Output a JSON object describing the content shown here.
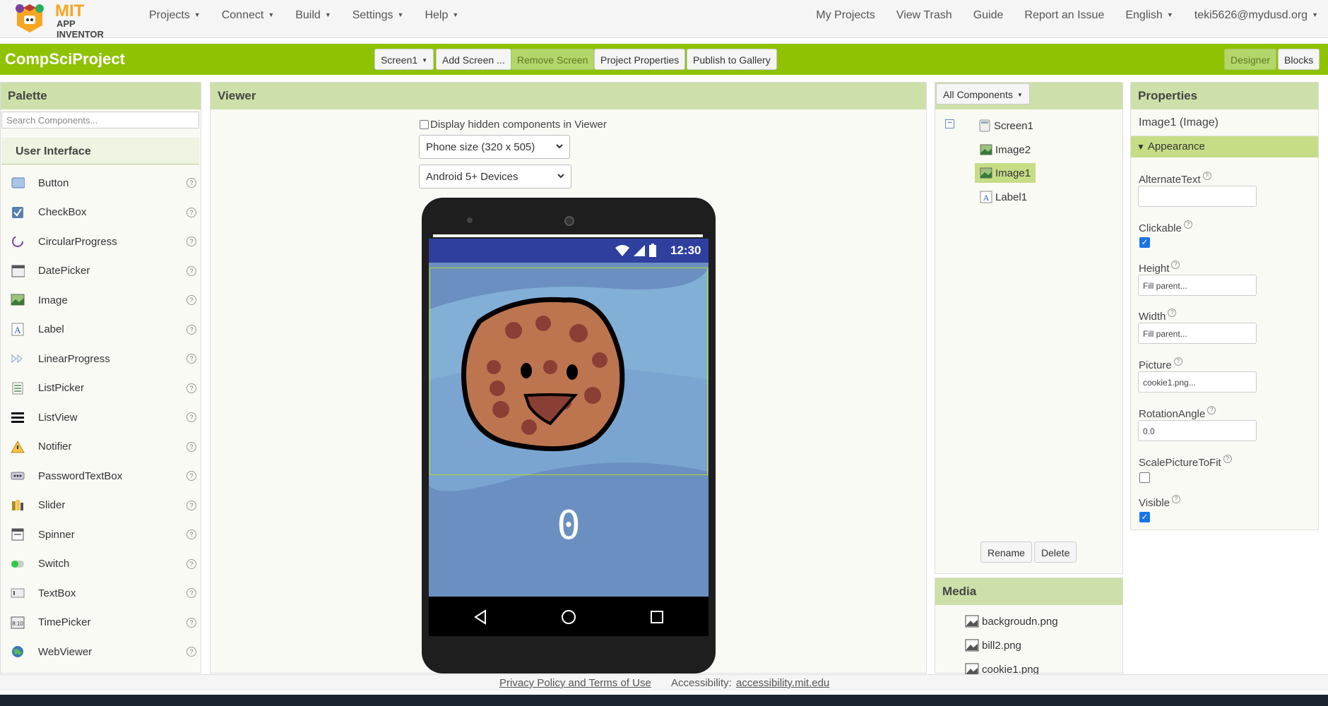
{
  "topnav": {
    "logo_mit": "MIT",
    "logo_sub": "APP INVENTOR",
    "left": [
      {
        "label": "Projects",
        "key": "projects"
      },
      {
        "label": "Connect",
        "key": "connect"
      },
      {
        "label": "Build",
        "key": "build"
      },
      {
        "label": "Settings",
        "key": "settings"
      },
      {
        "label": "Help",
        "key": "help"
      }
    ],
    "right": {
      "my_projects": "My Projects",
      "view_trash": "View Trash",
      "guide": "Guide",
      "report": "Report an Issue",
      "language": "English",
      "account": "teki5626@mydusd.org"
    }
  },
  "toolbar": {
    "project_name": "CompSciProject",
    "screen_select": "Screen1",
    "add_screen": "Add Screen ...",
    "remove_screen": "Remove Screen",
    "project_properties": "Project Properties",
    "publish": "Publish to Gallery",
    "designer": "Designer",
    "blocks": "Blocks"
  },
  "palette": {
    "title": "Palette",
    "search_placeholder": "Search Components...",
    "category": "User Interface",
    "items": [
      {
        "label": "Button",
        "icon": "button-icon"
      },
      {
        "label": "CheckBox",
        "icon": "checkbox-icon"
      },
      {
        "label": "CircularProgress",
        "icon": "circular-progress-icon"
      },
      {
        "label": "DatePicker",
        "icon": "datepicker-icon"
      },
      {
        "label": "Image",
        "icon": "image-icon"
      },
      {
        "label": "Label",
        "icon": "label-icon"
      },
      {
        "label": "LinearProgress",
        "icon": "linear-progress-icon"
      },
      {
        "label": "ListPicker",
        "icon": "listpicker-icon"
      },
      {
        "label": "ListView",
        "icon": "listview-icon"
      },
      {
        "label": "Notifier",
        "icon": "notifier-icon"
      },
      {
        "label": "PasswordTextBox",
        "icon": "password-icon"
      },
      {
        "label": "Slider",
        "icon": "slider-icon"
      },
      {
        "label": "Spinner",
        "icon": "spinner-icon"
      },
      {
        "label": "Switch",
        "icon": "switch-icon"
      },
      {
        "label": "TextBox",
        "icon": "textbox-icon"
      },
      {
        "label": "TimePicker",
        "icon": "timepicker-icon"
      },
      {
        "label": "WebViewer",
        "icon": "webviewer-icon"
      }
    ]
  },
  "viewer": {
    "title": "Viewer",
    "hidden_checkbox_label": "Display hidden components in Viewer",
    "size_select": "Phone size (320 x 505)",
    "device_select": "Android 5+ Devices",
    "status_time": "12:30",
    "label_text": "0"
  },
  "components": {
    "filter": "All Components",
    "tree": [
      {
        "label": "Screen1",
        "icon": "screen-icon"
      },
      {
        "label": "Image2",
        "icon": "image-icon"
      },
      {
        "label": "Image1",
        "icon": "image-icon",
        "selected": true
      },
      {
        "label": "Label1",
        "icon": "label-icon"
      }
    ],
    "rename": "Rename",
    "delete": "Delete"
  },
  "media": {
    "title": "Media",
    "files": [
      "backgroudn.png",
      "bill2.png",
      "cookie1.png"
    ]
  },
  "properties": {
    "title": "Properties",
    "component": "Image1 (Image)",
    "section": "Appearance",
    "alternate_text_label": "AlternateText",
    "alternate_text_value": "",
    "clickable_label": "Clickable",
    "clickable": true,
    "height_label": "Height",
    "height_value": "Fill parent...",
    "width_label": "Width",
    "width_value": "Fill parent...",
    "picture_label": "Picture",
    "picture_value": "cookie1.png...",
    "rotation_label": "RotationAngle",
    "rotation_value": "0.0",
    "scale_label": "ScalePictureToFit",
    "scale": false,
    "visible_label": "Visible",
    "visible": true
  },
  "footer": {
    "privacy": "Privacy Policy and Terms of Use",
    "accessibility_label": "Accessibility:",
    "accessibility_link": "accessibility.mit.edu"
  },
  "colors": {
    "brand_green": "#8fc202",
    "panel_header": "#cde0a9",
    "status_bar": "#2f3f9e"
  }
}
